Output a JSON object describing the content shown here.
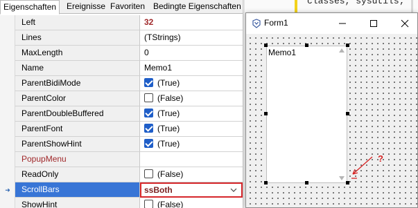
{
  "inspector": {
    "tabs": [
      "Eigenschaften",
      "Ereignisse",
      "Favoriten",
      "Bedingte Eigenschaften"
    ],
    "properties": [
      {
        "name": "Left",
        "value": "32",
        "name_red": false,
        "value_bold": true
      },
      {
        "name": "Lines",
        "value": "(TStrings)"
      },
      {
        "name": "MaxLength",
        "value": "0"
      },
      {
        "name": "Name",
        "value": "Memo1"
      },
      {
        "name": "ParentBidiMode",
        "value": "(True)",
        "checkbox": true
      },
      {
        "name": "ParentColor",
        "value": "(False)",
        "checkbox": false
      },
      {
        "name": "ParentDoubleBuffered",
        "value": "(True)",
        "checkbox": true
      },
      {
        "name": "ParentFont",
        "value": "(True)",
        "checkbox": true
      },
      {
        "name": "ParentShowHint",
        "value": "(True)",
        "checkbox": true
      },
      {
        "name": "PopupMenu",
        "value": "",
        "name_red": true
      },
      {
        "name": "ReadOnly",
        "value": "(False)",
        "checkbox": false
      },
      {
        "name": "ScrollBars",
        "value": "ssBoth",
        "selected": true,
        "dropdown": true
      },
      {
        "name": "ShowHint",
        "value": "(False)",
        "checkbox": false
      }
    ]
  },
  "editor": {
    "code_line": "classes, sysutils;"
  },
  "form": {
    "title": "Form1",
    "memo_text": "Memo1",
    "annotation": "?"
  },
  "colors": {
    "selection": "#3875d6",
    "highlight_border": "#d6262a",
    "accent_text": "#a0282a",
    "checkbox": "#1f5ec8"
  }
}
